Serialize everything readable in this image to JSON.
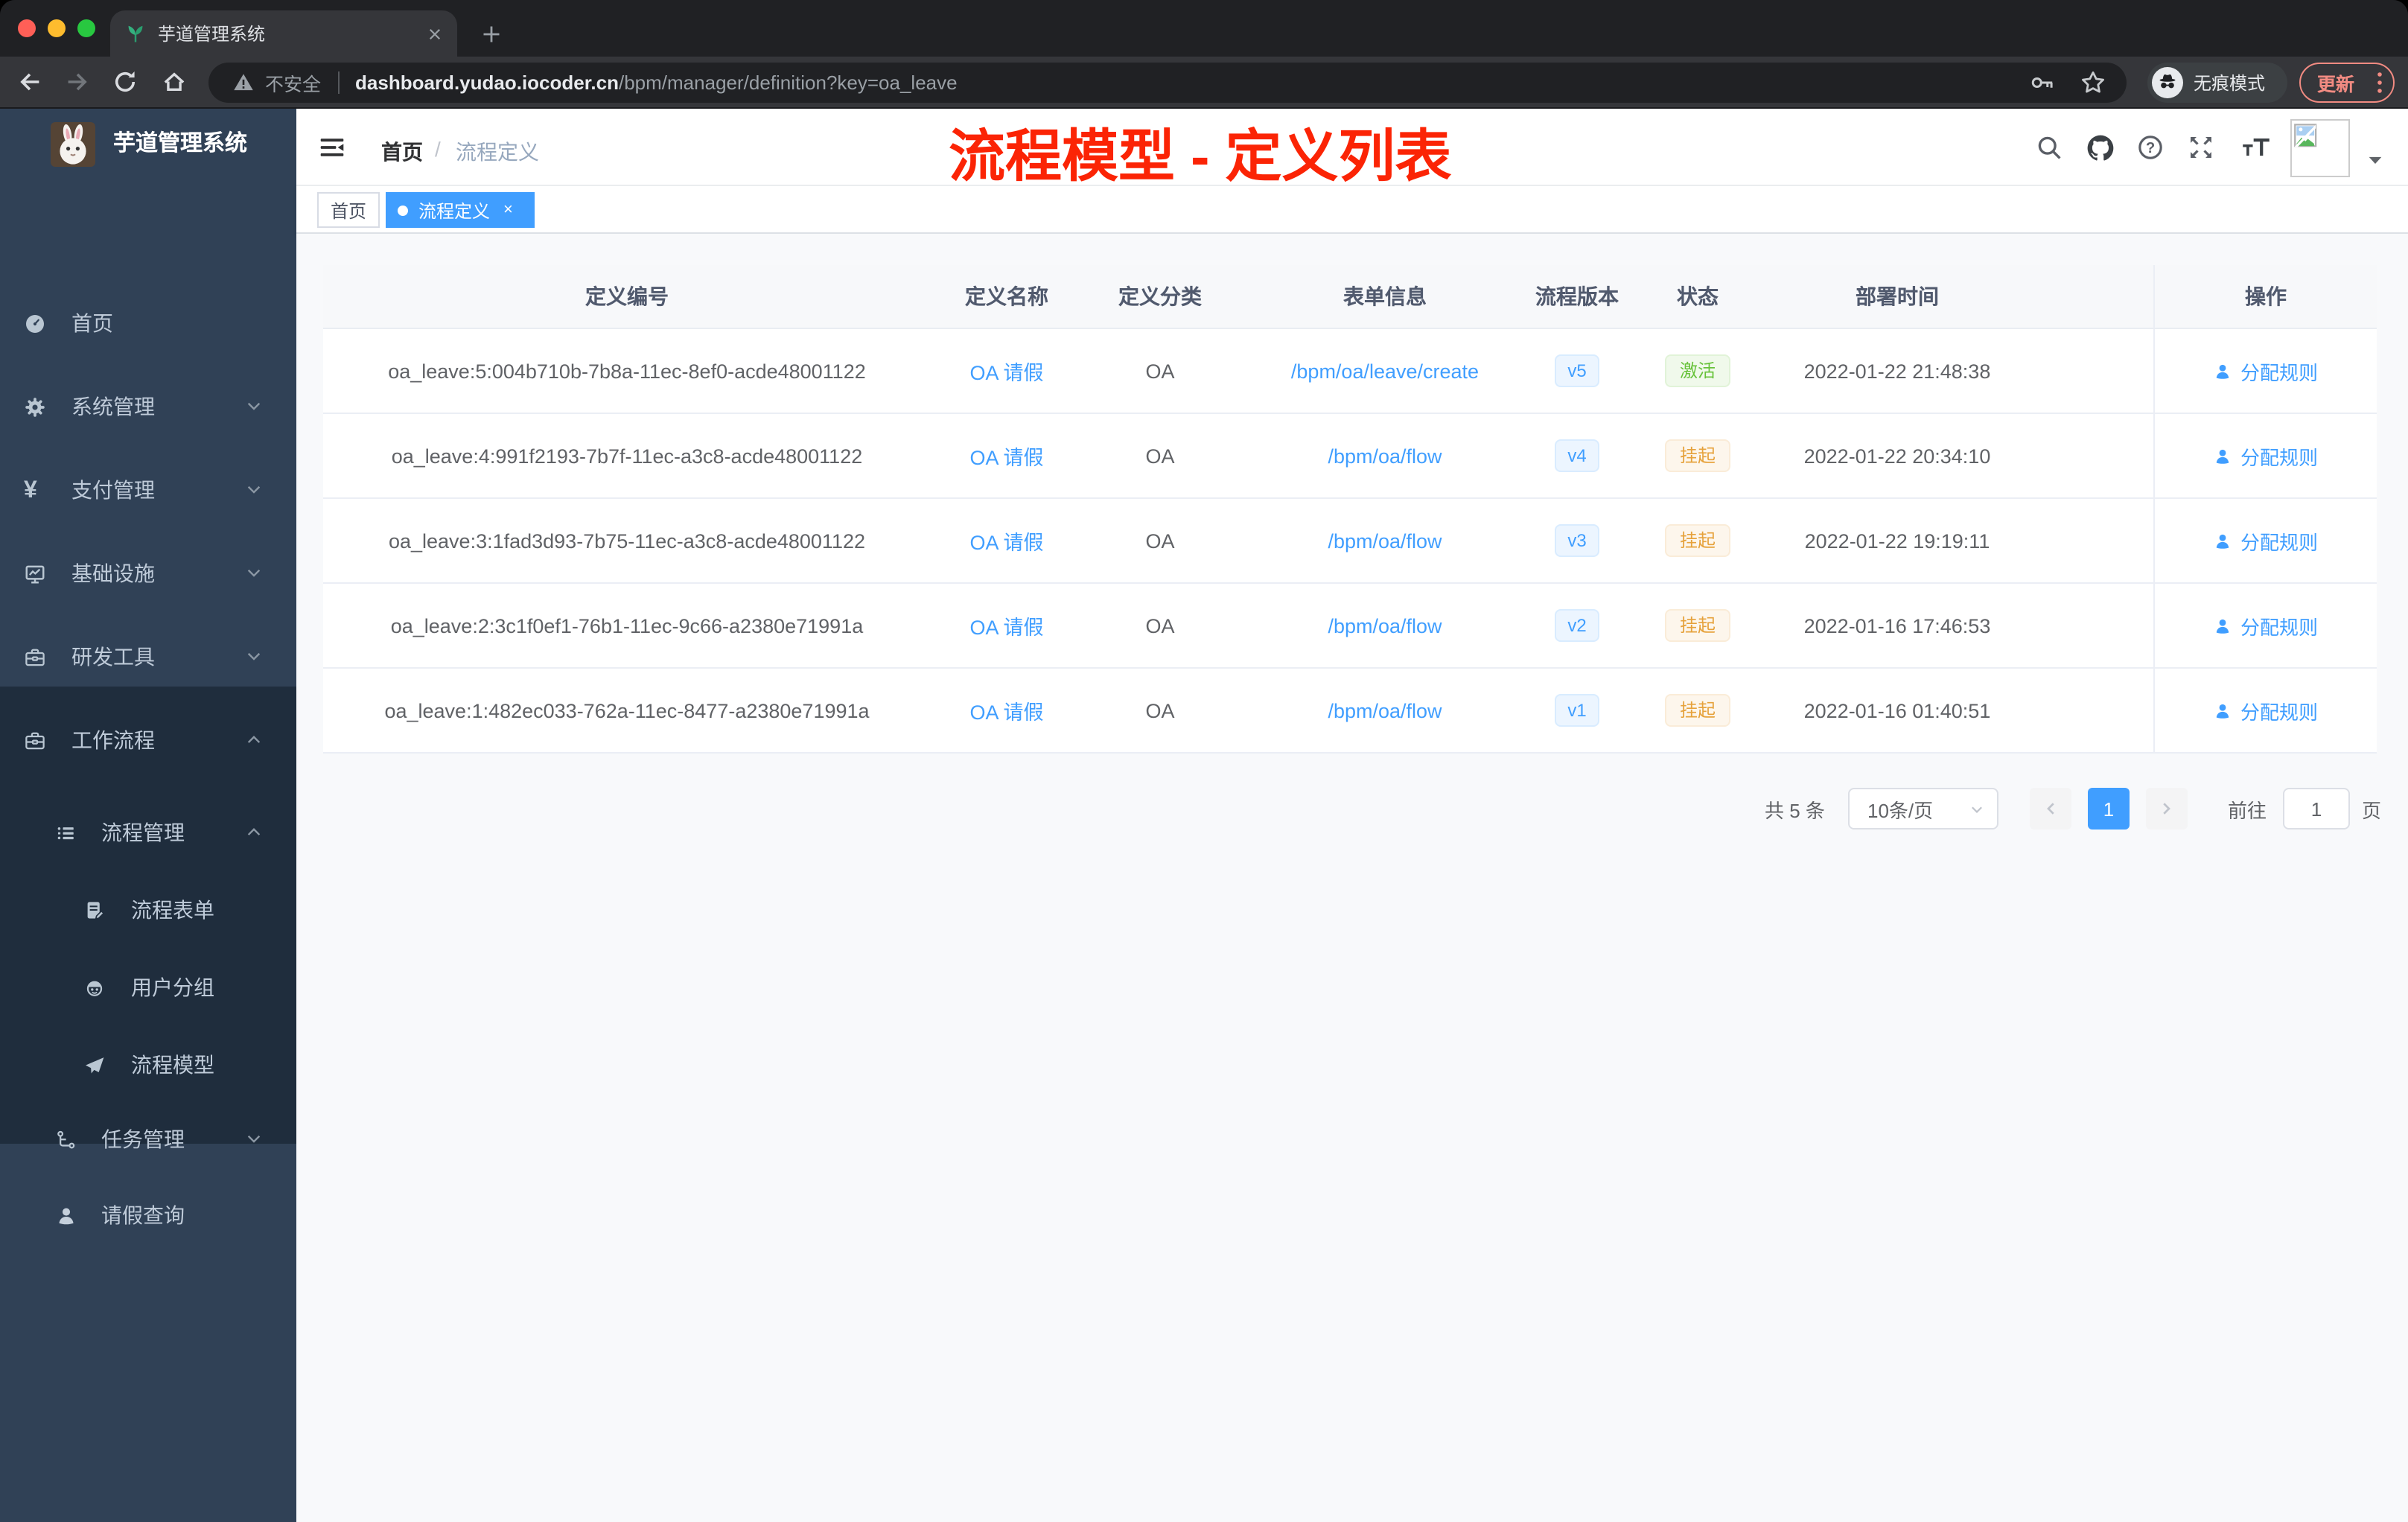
{
  "browser": {
    "tab_title": "芋道管理系统",
    "security_label": "不安全",
    "url_host": "dashboard.yudao.iocoder.cn",
    "url_path": "/bpm/manager/definition?key=oa_leave",
    "incognito_label": "无痕模式",
    "update_label": "更新"
  },
  "sidebar": {
    "logo_title": "芋道管理系统",
    "items": [
      {
        "label": "首页",
        "icon": "dashboard-icon"
      },
      {
        "label": "系统管理",
        "icon": "gear-icon",
        "chevron": "down"
      },
      {
        "label": "支付管理",
        "icon": "yen-icon",
        "chevron": "down"
      },
      {
        "label": "基础设施",
        "icon": "monitor-icon",
        "chevron": "down"
      },
      {
        "label": "研发工具",
        "icon": "toolbox-icon",
        "chevron": "down"
      },
      {
        "label": "工作流程",
        "icon": "briefcase-icon",
        "chevron": "up"
      },
      {
        "label": "流程管理",
        "icon": "tree-list-icon",
        "chevron": "up"
      },
      {
        "label": "流程表单",
        "icon": "form-doc-icon"
      },
      {
        "label": "用户分组",
        "icon": "user-group-icon"
      },
      {
        "label": "流程模型",
        "icon": "paper-plane-icon"
      },
      {
        "label": "任务管理",
        "icon": "task-branch-icon",
        "chevron": "down"
      },
      {
        "label": "请假查询",
        "icon": "person-icon"
      }
    ]
  },
  "header": {
    "breadcrumb_home": "首页",
    "breadcrumb_separator": "/",
    "breadcrumb_current": "流程定义",
    "annotation": "流程模型 - 定义列表"
  },
  "tags": {
    "home": "首页",
    "active": "流程定义"
  },
  "table": {
    "columns": [
      "定义编号",
      "定义名称",
      "定义分类",
      "表单信息",
      "流程版本",
      "状态",
      "部署时间",
      "操作"
    ],
    "rows": [
      {
        "id": "oa_leave:5:004b710b-7b8a-11ec-8ef0-acde48001122",
        "name": "OA 请假",
        "category": "OA",
        "form": "/bpm/oa/leave/create",
        "version": "v5",
        "status": "激活",
        "time": "2022-01-22 21:48:38",
        "action": "分配规则"
      },
      {
        "id": "oa_leave:4:991f2193-7b7f-11ec-a3c8-acde48001122",
        "name": "OA 请假",
        "category": "OA",
        "form": "/bpm/oa/flow",
        "version": "v4",
        "status": "挂起",
        "time": "2022-01-22 20:34:10",
        "action": "分配规则"
      },
      {
        "id": "oa_leave:3:1fad3d93-7b75-11ec-a3c8-acde48001122",
        "name": "OA 请假",
        "category": "OA",
        "form": "/bpm/oa/flow",
        "version": "v3",
        "status": "挂起",
        "time": "2022-01-22 19:19:11",
        "action": "分配规则"
      },
      {
        "id": "oa_leave:2:3c1f0ef1-76b1-11ec-9c66-a2380e71991a",
        "name": "OA 请假",
        "category": "OA",
        "form": "/bpm/oa/flow",
        "version": "v2",
        "status": "挂起",
        "time": "2022-01-16 17:46:53",
        "action": "分配规则"
      },
      {
        "id": "oa_leave:1:482ec033-762a-11ec-8477-a2380e71991a",
        "name": "OA 请假",
        "category": "OA",
        "form": "/bpm/oa/flow",
        "version": "v1",
        "status": "挂起",
        "time": "2022-01-16 01:40:51",
        "action": "分配规则"
      }
    ]
  },
  "pagination": {
    "total": "共 5 条",
    "page_size": "10条/页",
    "current_page": "1",
    "goto_label": "前往",
    "goto_value": "1",
    "page_unit": "页"
  },
  "colors": {
    "accent_blue": "#409eff",
    "success_green": "#67c23a",
    "warning_orange": "#e6a23c",
    "annotation_red": "#fb2405",
    "sidebar_bg": "#304156",
    "submenu_bg": "#1f2d3d"
  }
}
